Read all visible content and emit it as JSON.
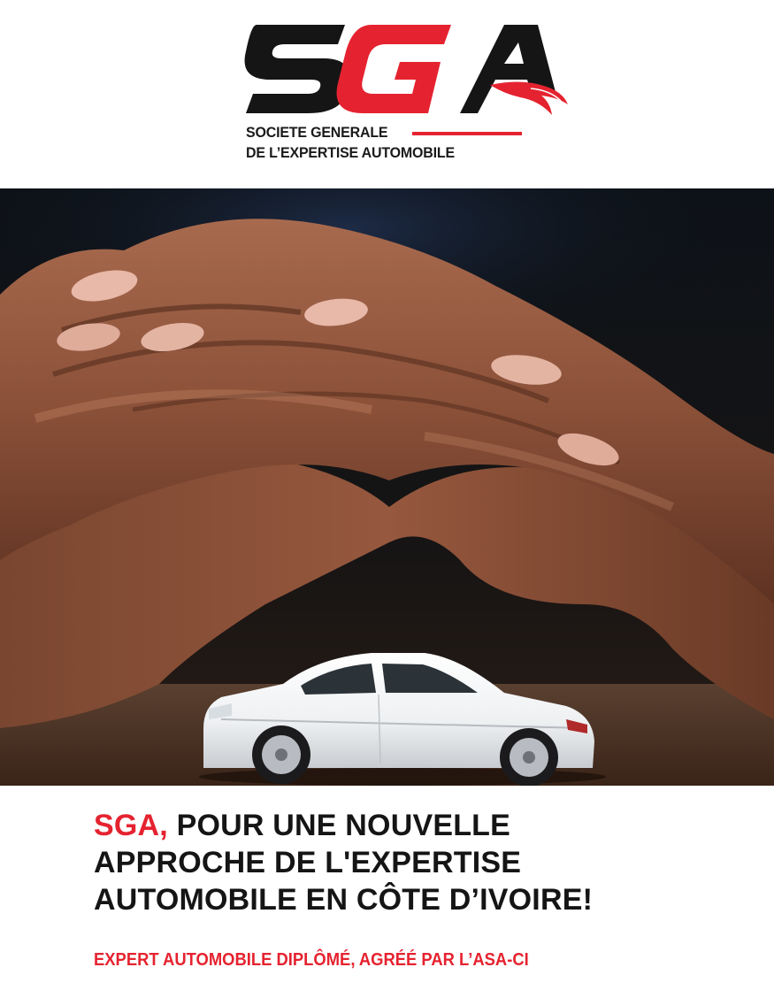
{
  "logo": {
    "mark": "SGA",
    "tagline_line1": "SOCIETE GENERALE",
    "tagline_line2": "DE L’EXPERTISE AUTOMOBILE",
    "colors": {
      "black": "#151515",
      "red": "#e52330"
    }
  },
  "hero_image": {
    "subject": "hands-sheltering-white-toy-car"
  },
  "headline": {
    "brand": "SGA,",
    "line1_rest": " POUR UNE NOUVELLE",
    "line2": "APPROCHE DE L'EXPERTISE",
    "line3": "AUTOMOBILE EN CÔTE D’IVOIRE!"
  },
  "subline": "EXPERT AUTOMOBILE DIPLÔMÉ, AGRÉÉ PAR L’ASA-CI",
  "colors": {
    "accent": "#e52330",
    "text": "#151515",
    "background": "#ffffff"
  }
}
